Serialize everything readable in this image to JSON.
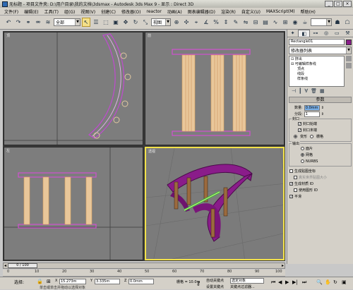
{
  "titlebar": {
    "title": "无标题   - 项目文件夹: D:\\用户目录\\我的文档\\3dsmax     - Autodesk 3ds Max 9     - 显示 : Direct 3D",
    "buttons": [
      "_",
      "□",
      "×"
    ]
  },
  "menubar": {
    "items": [
      "文件(F)",
      "编辑(E)",
      "工具(T)",
      "组(G)",
      "视图(V)",
      "创建(C)",
      "修改器(O)",
      "reactor",
      "动画(A)",
      "图表编辑器(D)",
      "渲染(R)",
      "自定义(U)",
      "MAXScript(M)",
      "帮助(H)"
    ]
  },
  "toolbar": {
    "filter_select": "全部",
    "coord_select": "视图"
  },
  "viewports": {
    "top_label": "顶",
    "front_label": "前",
    "left_label": "左",
    "persp_label": "透视"
  },
  "cmdpanel": {
    "object_name": "Rectangle01",
    "modifier_list": "修改器列表",
    "stack": {
      "root": "挤出",
      "child": "可编辑样条线",
      "subs": [
        "顶点",
        "线段",
        "样条线"
      ]
    },
    "params_title": "参数",
    "amount_label": "数量:",
    "amount_value": "0.0mm",
    "segments_label": "分段:",
    "segments_value": "1",
    "capping_title": "封口",
    "cap_start": "封口始端",
    "cap_end": "封口末端",
    "morph": "变形",
    "grid": "栅格",
    "output_title": "输出",
    "patch": "面片",
    "mesh": "网格",
    "nurbs": "NURBS",
    "gen_mapping": "生成贴图坐标",
    "real_world": "真实世界贴图大小",
    "gen_mat_ids": "生成材质 ID",
    "use_shape_ids": "使用图形 ID",
    "smooth": "平滑"
  },
  "timeline": {
    "frame_display": "0 / 100",
    "ticks": [
      "0",
      "10",
      "20",
      "30",
      "40",
      "50",
      "60",
      "70",
      "80",
      "90",
      "100"
    ]
  },
  "statusbar": {
    "selection": "选择:",
    "x_label": "X",
    "x_value": "15.273m",
    "y_label": "Y",
    "y_value": "3.335m",
    "z_label": "Z",
    "z_value": "0.0mm",
    "grid": "栅格 = 10.0m",
    "auto_key": "自动关键点",
    "set_key": "设置关键点",
    "selected": "选定对象",
    "key_filters": "关键点过滤器...",
    "prompt": "单击或单击并拖动以选择对象"
  }
}
